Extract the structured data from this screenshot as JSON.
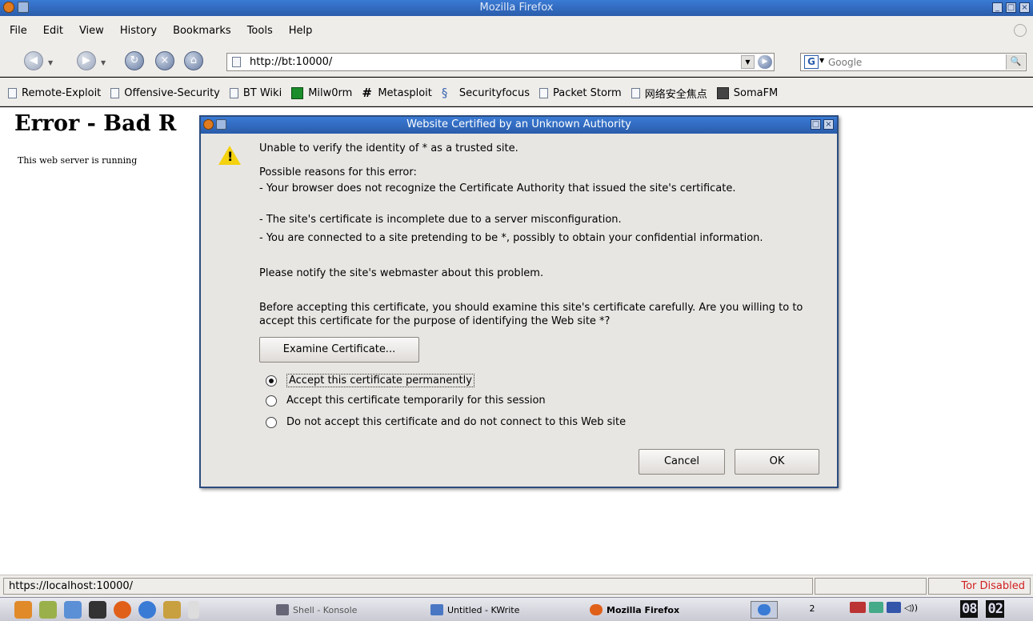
{
  "window": {
    "title": "Mozilla Firefox"
  },
  "menu": [
    "File",
    "Edit",
    "View",
    "History",
    "Bookmarks",
    "Tools",
    "Help"
  ],
  "nav": {
    "url": "http://bt:10000/",
    "search_placeholder": "Google"
  },
  "bookmarks": [
    {
      "label": "Remote-Exploit",
      "icon": "page-icon"
    },
    {
      "label": "Offensive-Security",
      "icon": "page-icon"
    },
    {
      "label": "BT Wiki",
      "icon": "page-icon"
    },
    {
      "label": "Milw0rm",
      "icon": "milw0rm-icon"
    },
    {
      "label": "Metasploit",
      "icon": "hash-icon"
    },
    {
      "label": "Securityfocus",
      "icon": "securityfocus-icon"
    },
    {
      "label": "Packet Storm",
      "icon": "page-icon"
    },
    {
      "label": "网络安全焦点",
      "icon": "page-icon"
    },
    {
      "label": "SomaFM",
      "icon": "somafm-icon"
    }
  ],
  "page": {
    "heading": "Error - Bad R",
    "message": "This web server is running"
  },
  "dialog": {
    "title": "Website Certified by an Unknown Authority",
    "line1": "Unable to verify the identity of * as a trusted site.",
    "reasons_header": "Possible reasons for this error:",
    "reason1": "- Your browser does not recognize the Certificate Authority that issued the site's certificate.",
    "reason2": "- The site's certificate is incomplete due to a server misconfiguration.",
    "reason3": "- You are connected to a site pretending to be *, possibly to obtain your confidential information.",
    "notify": "Please notify the site's webmaster about this problem.",
    "before": "Before accepting this certificate, you should examine this site's certificate carefully. Are you willing to to accept this certificate for the purpose of identifying the Web site *?",
    "examine_label": "Examine Certificate...",
    "options": [
      {
        "label": "Accept this certificate permanently",
        "selected": true
      },
      {
        "label": "Accept this certificate temporarily for this session",
        "selected": false
      },
      {
        "label": "Do not accept this certificate and do not connect to this Web site",
        "selected": false
      }
    ],
    "cancel_label": "Cancel",
    "ok_label": "OK"
  },
  "status": {
    "url": "https://localhost:10000/",
    "tor": "Tor Disabled"
  },
  "taskbar": {
    "tasks": [
      {
        "label": "Shell - Konsole"
      },
      {
        "label": "Untitled - KWrite"
      },
      {
        "label": "Mozilla Firefox"
      }
    ],
    "pager": [
      "2"
    ],
    "clock": [
      "08",
      "02"
    ]
  }
}
